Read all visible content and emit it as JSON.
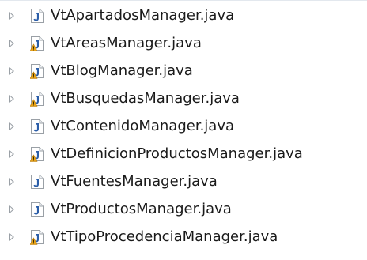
{
  "tree": {
    "files": [
      {
        "label": "VtApartadosManager.java",
        "warning": false
      },
      {
        "label": "VtAreasManager.java",
        "warning": true
      },
      {
        "label": "VtBlogManager.java",
        "warning": true
      },
      {
        "label": "VtBusquedasManager.java",
        "warning": true
      },
      {
        "label": "VtContenidoManager.java",
        "warning": false
      },
      {
        "label": "VtDefinicionProductosManager.java",
        "warning": true
      },
      {
        "label": "VtFuentesManager.java",
        "warning": false
      },
      {
        "label": "VtProductosManager.java",
        "warning": false
      },
      {
        "label": "VtTipoProcedenciaManager.java",
        "warning": true
      }
    ]
  },
  "colors": {
    "page_bg": "#ffffff",
    "text": "#1a1a1a",
    "twisty": "#9aa0a6",
    "java_j": "#2a5da8",
    "warning": "#e8a317"
  },
  "icons": {
    "expand": "chevron-right-icon",
    "file": "java-file-icon",
    "overlay": "warning-icon"
  }
}
